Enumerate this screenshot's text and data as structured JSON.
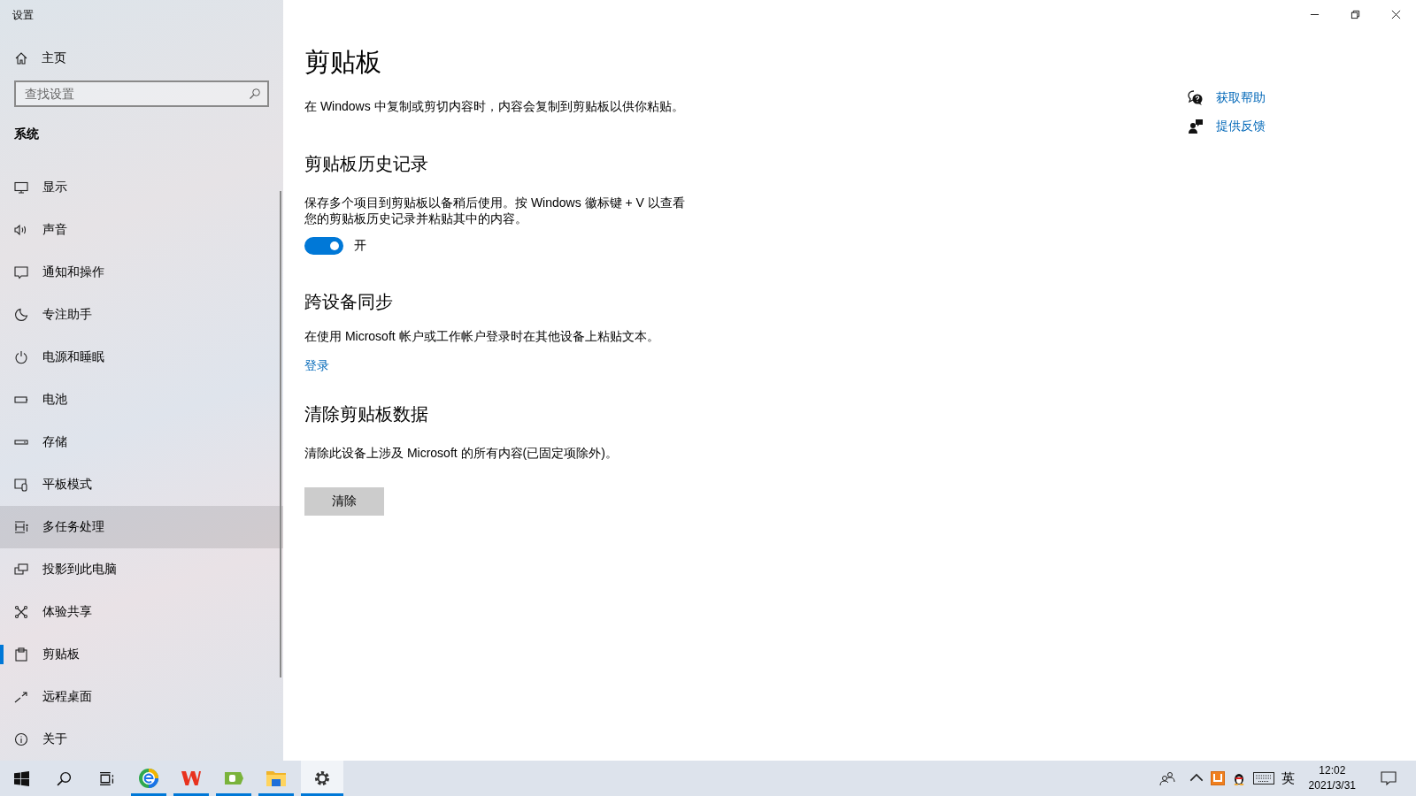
{
  "window": {
    "title": "设置"
  },
  "sidebar": {
    "home": "主页",
    "search": {
      "placeholder": "查找设置"
    },
    "section": "系统",
    "items": [
      {
        "label": "显示",
        "selected": false,
        "hovered": false
      },
      {
        "label": "声音",
        "selected": false,
        "hovered": false
      },
      {
        "label": "通知和操作",
        "selected": false,
        "hovered": false
      },
      {
        "label": "专注助手",
        "selected": false,
        "hovered": false
      },
      {
        "label": "电源和睡眠",
        "selected": false,
        "hovered": false
      },
      {
        "label": "电池",
        "selected": false,
        "hovered": false
      },
      {
        "label": "存储",
        "selected": false,
        "hovered": false
      },
      {
        "label": "平板模式",
        "selected": false,
        "hovered": false
      },
      {
        "label": "多任务处理",
        "selected": false,
        "hovered": true
      },
      {
        "label": "投影到此电脑",
        "selected": false,
        "hovered": false
      },
      {
        "label": "体验共享",
        "selected": false,
        "hovered": false
      },
      {
        "label": "剪贴板",
        "selected": true,
        "hovered": false
      },
      {
        "label": "远程桌面",
        "selected": false,
        "hovered": false
      },
      {
        "label": "关于",
        "selected": false,
        "hovered": false
      }
    ]
  },
  "page": {
    "title": "剪贴板",
    "intro": "在 Windows 中复制或剪切内容时，内容会复制到剪贴板以供你粘贴。",
    "sections": [
      {
        "kind": "toggle",
        "heading": "剪贴板历史记录",
        "text": "保存多个项目到剪贴板以备稍后使用。按 Windows 徽标键 + V 以查看您的剪贴板历史记录并粘贴其中的内容。",
        "on": true,
        "state_label": "开"
      },
      {
        "kind": "link",
        "heading": "跨设备同步",
        "text": "在使用 Microsoft 帐户或工作帐户登录时在其他设备上粘贴文本。",
        "link": "登录"
      },
      {
        "kind": "button",
        "heading": "清除剪贴板数据",
        "text": "清除此设备上涉及 Microsoft 的所有内容(已固定项除外)。",
        "button": "清除"
      }
    ]
  },
  "help_links": [
    "获取帮助",
    "提供反馈"
  ],
  "taskbar": {
    "apps": [
      {
        "running": true,
        "active": false
      },
      {
        "running": true,
        "active": false
      },
      {
        "running": true,
        "active": false
      },
      {
        "running": true,
        "active": false
      },
      {
        "running": true,
        "active": true
      }
    ],
    "ime": "英",
    "time": "12:02",
    "date": "2021/3/31"
  }
}
